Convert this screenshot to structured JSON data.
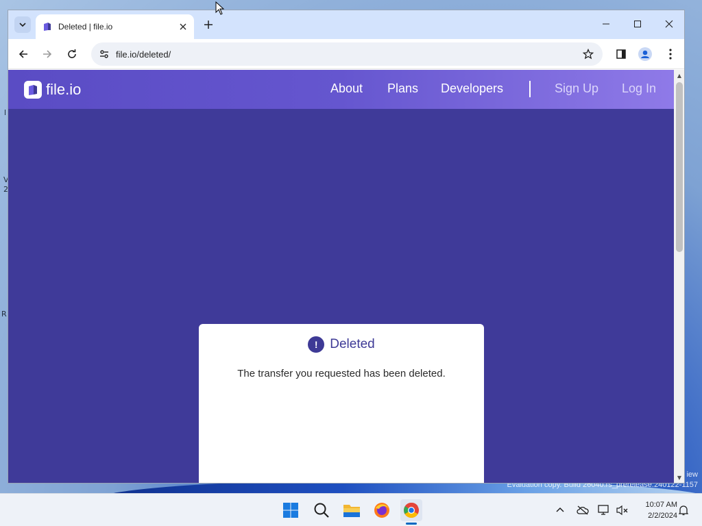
{
  "desktop": {
    "fragments": [
      "l",
      "V",
      "2",
      "R"
    ],
    "watermark_line1": "iew",
    "watermark_line2": "Evaluation copy. Build 26040.rs_prerelease.240122-1157"
  },
  "browser": {
    "tab": {
      "title": "Deleted | file.io"
    },
    "address": {
      "url": "file.io/deleted/"
    }
  },
  "site": {
    "logo_text": "file.io",
    "nav": {
      "about": "About",
      "plans": "Plans",
      "developers": "Developers",
      "signup": "Sign Up",
      "login": "Log In"
    },
    "card": {
      "icon": "!",
      "title": "Deleted",
      "message": "The transfer you requested has been deleted."
    }
  },
  "taskbar": {
    "time": "10:07 AM",
    "date": "2/2/2024"
  },
  "colors": {
    "page_background": "#3f3a99",
    "header_gradient_start": "#5a4cc4",
    "header_gradient_end": "#8f7ae8",
    "accent": "#3e3a96",
    "tabstrip": "#d3e3fd"
  }
}
